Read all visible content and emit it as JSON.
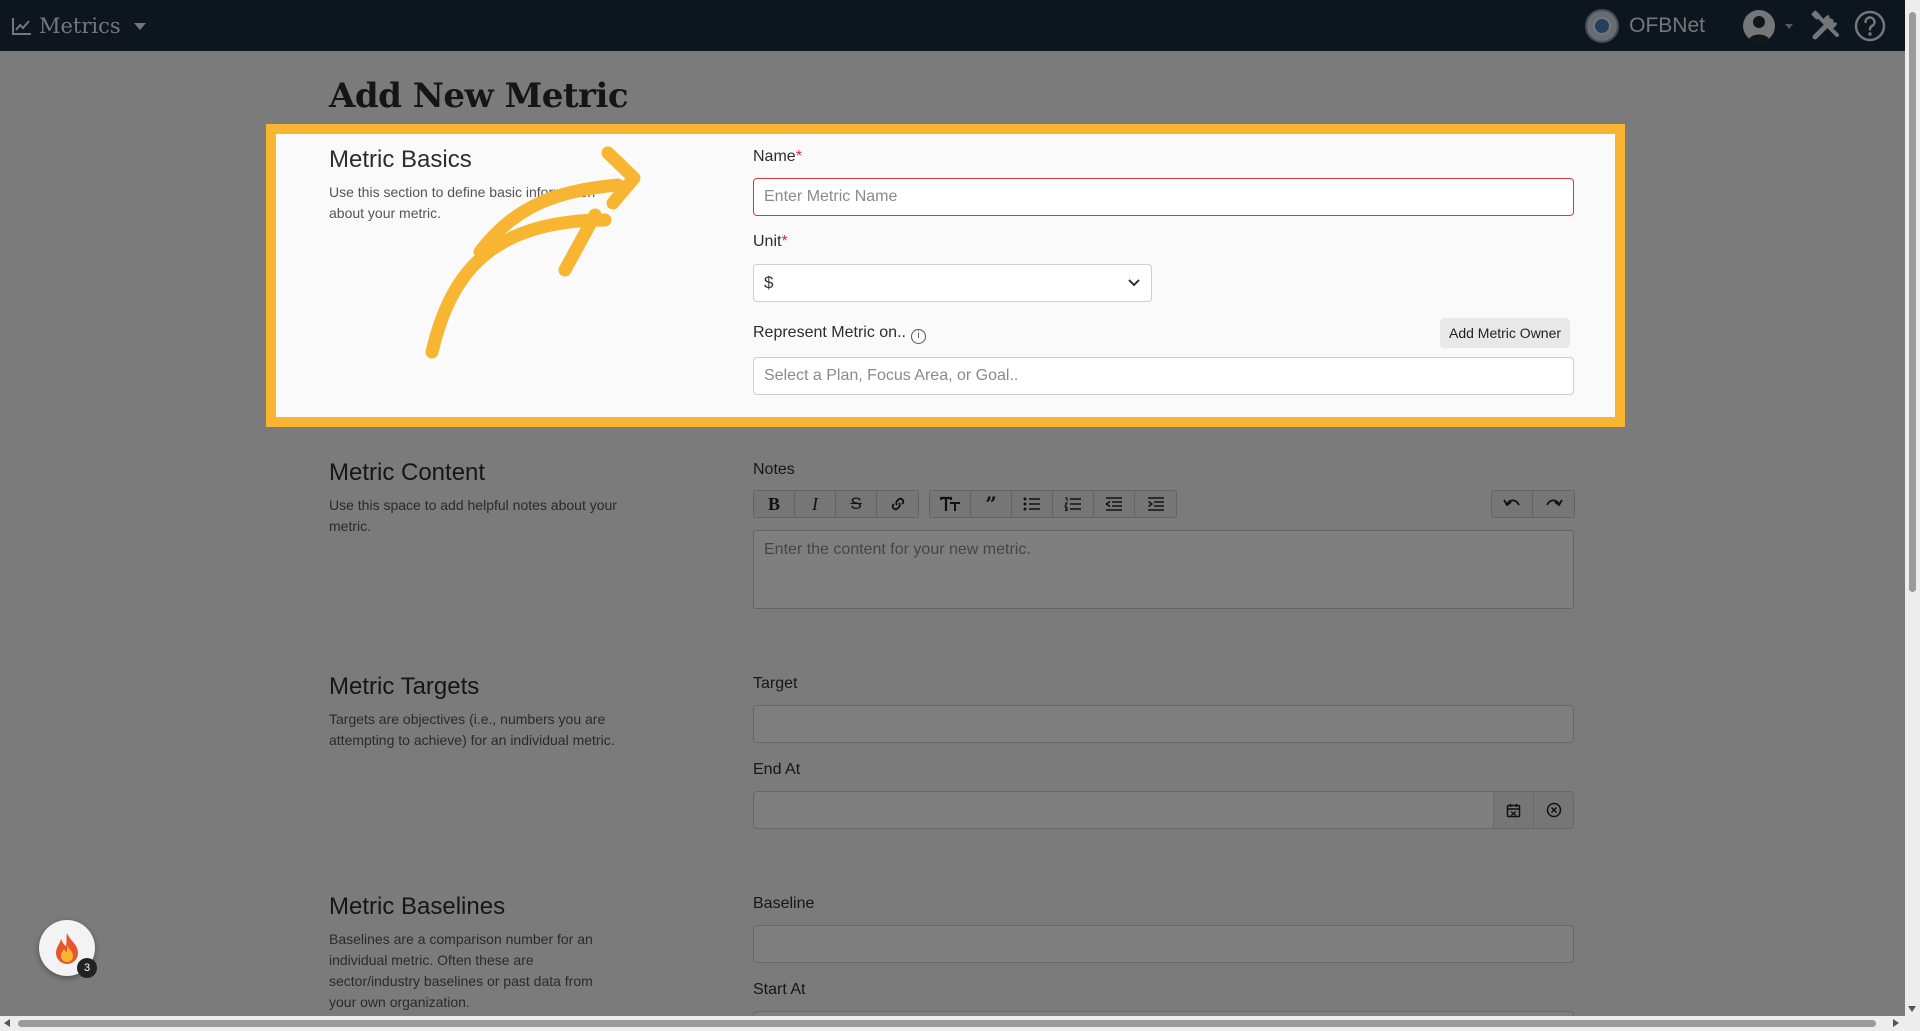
{
  "nav": {
    "app_name": "Metrics",
    "org_name": "OFBNet"
  },
  "page": {
    "title": "Add New Metric"
  },
  "basics": {
    "title": "Metric Basics",
    "description": "Use this section to define basic information about your metric.",
    "name_label": "Name",
    "name_placeholder": "Enter Metric Name",
    "unit_label": "Unit",
    "unit_value": "$",
    "represent_label": "Represent Metric on..",
    "represent_placeholder": "Select a Plan, Focus Area, or Goal..",
    "add_owner_label": "Add Metric Owner",
    "required_mark": "*"
  },
  "content": {
    "title": "Metric Content",
    "description": "Use this space to add helpful notes about your metric.",
    "notes_label": "Notes",
    "notes_placeholder": "Enter the content for your new metric."
  },
  "targets": {
    "title": "Metric Targets",
    "description": "Targets are objectives (i.e., numbers you are attempting to achieve) for an individual metric.",
    "target_label": "Target",
    "end_at_label": "End At"
  },
  "baselines": {
    "title": "Metric Baselines",
    "description": "Baselines are a comparison number for an individual metric. Often these are sector/industry baselines or past data from your own organization.",
    "baseline_label": "Baseline",
    "start_at_label": "Start At"
  },
  "widget": {
    "count": "3"
  },
  "colors": {
    "nav_bg": "#1b2b3c",
    "highlight": "#f7b531",
    "required": "#e0283a"
  }
}
